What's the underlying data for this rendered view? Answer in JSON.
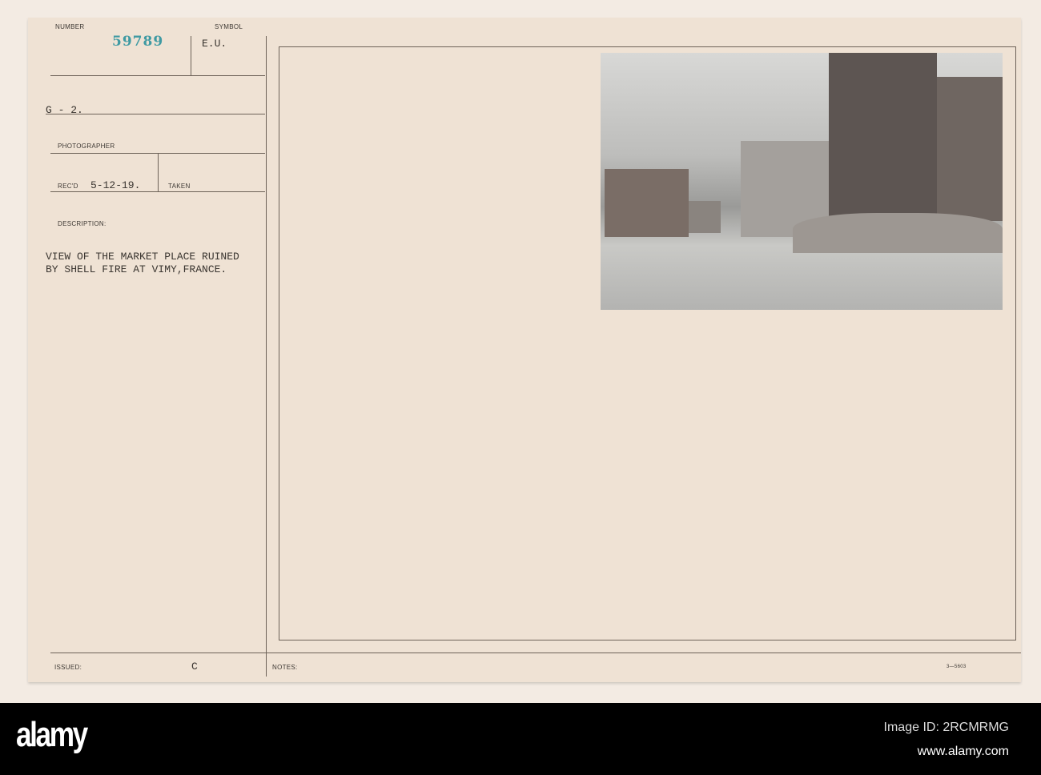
{
  "record": {
    "number_label": "NUMBER",
    "number": "59789",
    "symbol_label": "SYMBOL",
    "symbol": "E.U.",
    "unit": "G - 2.",
    "photographer_label": "PHOTOGRAPHER",
    "recd_label": "REC'D",
    "recd_date": "5-12-19.",
    "taken_label": "TAKEN",
    "description_label": "DESCRIPTION:",
    "description_lines": [
      "VIEW OF THE MARKET PLACE RUINED",
      "BY SHELL FIRE AT VIMY,FRANCE."
    ],
    "issued_label": "ISSUED:",
    "issued_mark": "C",
    "notes_label": "NOTES:",
    "form_number": "3—5603"
  },
  "footer": {
    "logo": "alamy",
    "image_id": "Image ID: 2RCMRMG",
    "url": "www.alamy.com"
  }
}
